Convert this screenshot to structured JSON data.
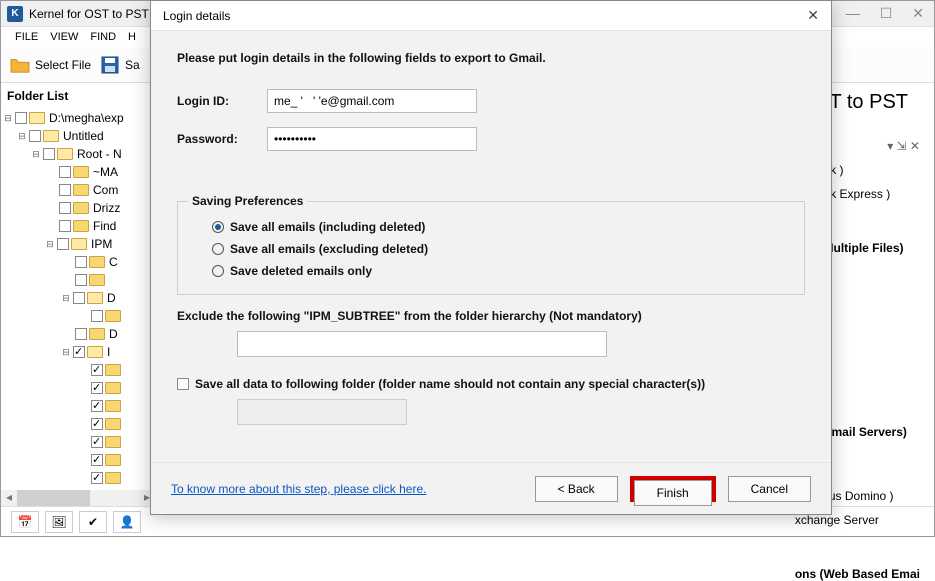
{
  "app": {
    "title": "Kernel for OST to PST",
    "product_suffix": "ST to PST"
  },
  "menu": {
    "file": "FILE",
    "view": "VIEW",
    "find": "FIND",
    "help": "H"
  },
  "toolbar": {
    "select_file": "Select File",
    "save": "Sa"
  },
  "folder_panel": {
    "title": "Folder List",
    "tree": {
      "root": "D:\\megha\\exp",
      "untitled": "Untitled",
      "rootn": "Root - N",
      "ma": "~MA",
      "com": "Com",
      "drizz": "Drizz",
      "find": "Find",
      "ipm": "IPM",
      "c": "C",
      "d1": "D",
      "d2": "D",
      "i": "I"
    }
  },
  "right": {
    "outlook": "Outlook )",
    "outlook_express": "Outlook Express )",
    "multi_files": "ons (Multiple Files)",
    "email_servers": "ons (Email Servers)",
    "lotus": "o ( Lotus Domino )",
    "exchange": "xchange Server",
    "web": "ons (Web Based Emai",
    "pin_marks": "▾ ⇲ ✕"
  },
  "bottom": {
    "b1": "📅",
    "b2": "🖼",
    "b3": "✔",
    "b4": "👤"
  },
  "dialog": {
    "title": "Login details",
    "instruction": "Please put login details in the following fields to export to Gmail.",
    "login_label": "Login ID:",
    "login_value": "me_ '   ' 'e@gmail.com",
    "password_label": "Password:",
    "password_value": "••••••••••",
    "group_title": "Saving Preferences",
    "opt1": "Save all emails (including deleted)",
    "opt2": "Save all emails (excluding deleted)",
    "opt3": "Save deleted emails only",
    "exclude_label": "Exclude the following \"IPM_SUBTREE\" from the folder hierarchy (Not mandatory)",
    "saveto_label": "Save all data to following folder (folder name should not contain any special character(s))",
    "help": "To know more about this step, please click here.",
    "back": "< Back",
    "finish": "Finish",
    "cancel": "Cancel"
  }
}
